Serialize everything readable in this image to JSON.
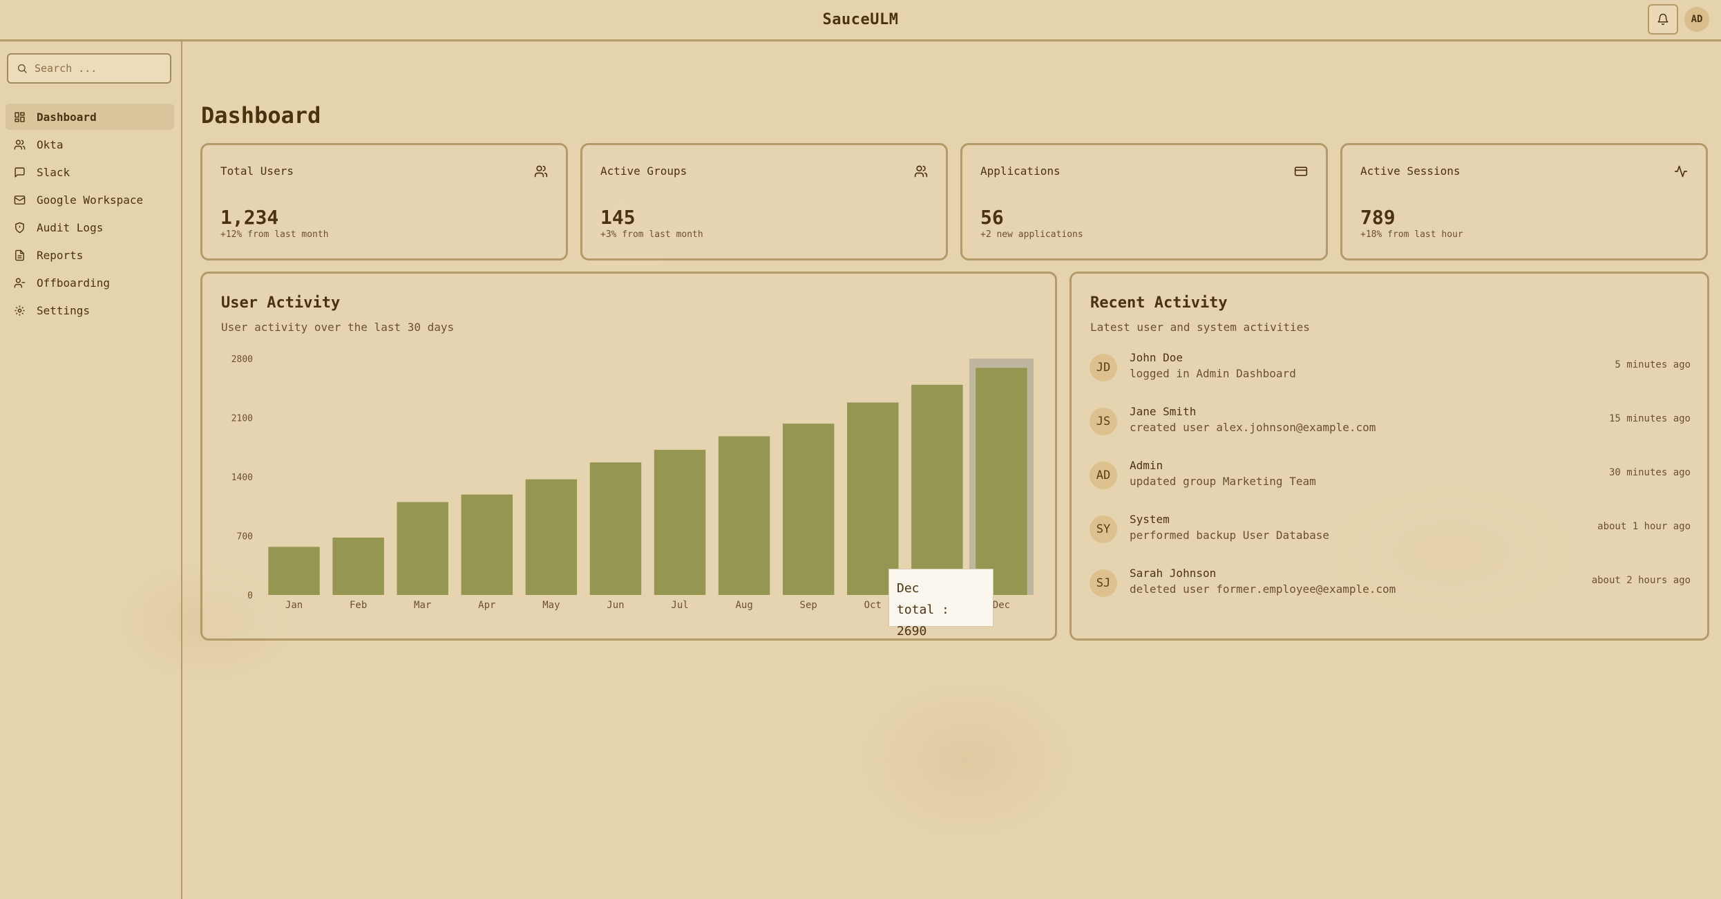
{
  "app": {
    "title": "SauceULM",
    "user_initials": "AD"
  },
  "search": {
    "placeholder": "Search ..."
  },
  "sidebar": {
    "items": [
      {
        "label": "Dashboard",
        "icon": "grid-icon",
        "active": true
      },
      {
        "label": "Okta",
        "icon": "users-icon"
      },
      {
        "label": "Slack",
        "icon": "message-icon"
      },
      {
        "label": "Google Workspace",
        "icon": "mail-icon"
      },
      {
        "label": "Audit Logs",
        "icon": "shield-icon"
      },
      {
        "label": "Reports",
        "icon": "file-icon"
      },
      {
        "label": "Offboarding",
        "icon": "user-minus-icon"
      },
      {
        "label": "Settings",
        "icon": "gear-icon"
      }
    ]
  },
  "page": {
    "title": "Dashboard"
  },
  "stats": [
    {
      "label": "Total Users",
      "value": "1,234",
      "sub": "+12% from last month",
      "icon": "users-icon"
    },
    {
      "label": "Active Groups",
      "value": "145",
      "sub": "+3% from last month",
      "icon": "users-icon"
    },
    {
      "label": "Applications",
      "value": "56",
      "sub": "+2 new applications",
      "icon": "credit-card-icon"
    },
    {
      "label": "Active Sessions",
      "value": "789",
      "sub": "+18% from last hour",
      "icon": "activity-icon"
    }
  ],
  "user_activity": {
    "title": "User Activity",
    "subtitle": "User activity over the last 30 days",
    "tooltip": {
      "label": "Dec",
      "text": "total : 2690"
    }
  },
  "chart_data": {
    "type": "bar",
    "categories": [
      "Jan",
      "Feb",
      "Mar",
      "Apr",
      "May",
      "Jun",
      "Jul",
      "Aug",
      "Sep",
      "Oct",
      "Nov",
      "Dec"
    ],
    "values": [
      570,
      680,
      1100,
      1190,
      1370,
      1570,
      1720,
      1880,
      2030,
      2280,
      2490,
      2690
    ],
    "yticks": [
      0,
      700,
      1400,
      2100,
      2800
    ],
    "ylim": [
      0,
      2800
    ],
    "bar_color": "#959652",
    "highlight": "Dec",
    "grid": false
  },
  "recent_activity": {
    "title": "Recent Activity",
    "subtitle": "Latest user and system activities",
    "items": [
      {
        "initials": "JD",
        "name": "John Doe",
        "desc": "logged in Admin Dashboard",
        "time": "5 minutes ago"
      },
      {
        "initials": "JS",
        "name": "Jane Smith",
        "desc": "created user alex.johnson@example.com",
        "time": "15 minutes ago"
      },
      {
        "initials": "AD",
        "name": "Admin",
        "desc": "updated group Marketing Team",
        "time": "30 minutes ago"
      },
      {
        "initials": "SY",
        "name": "System",
        "desc": "performed backup User Database",
        "time": "about 1 hour ago"
      },
      {
        "initials": "SJ",
        "name": "Sarah Johnson",
        "desc": "deleted user former.employee@example.com",
        "time": "about 2 hours ago"
      }
    ]
  },
  "colors": {
    "accent": "#959652",
    "border": "#b39a6a",
    "text": "#4a3210",
    "background": "#e5d3ad"
  }
}
